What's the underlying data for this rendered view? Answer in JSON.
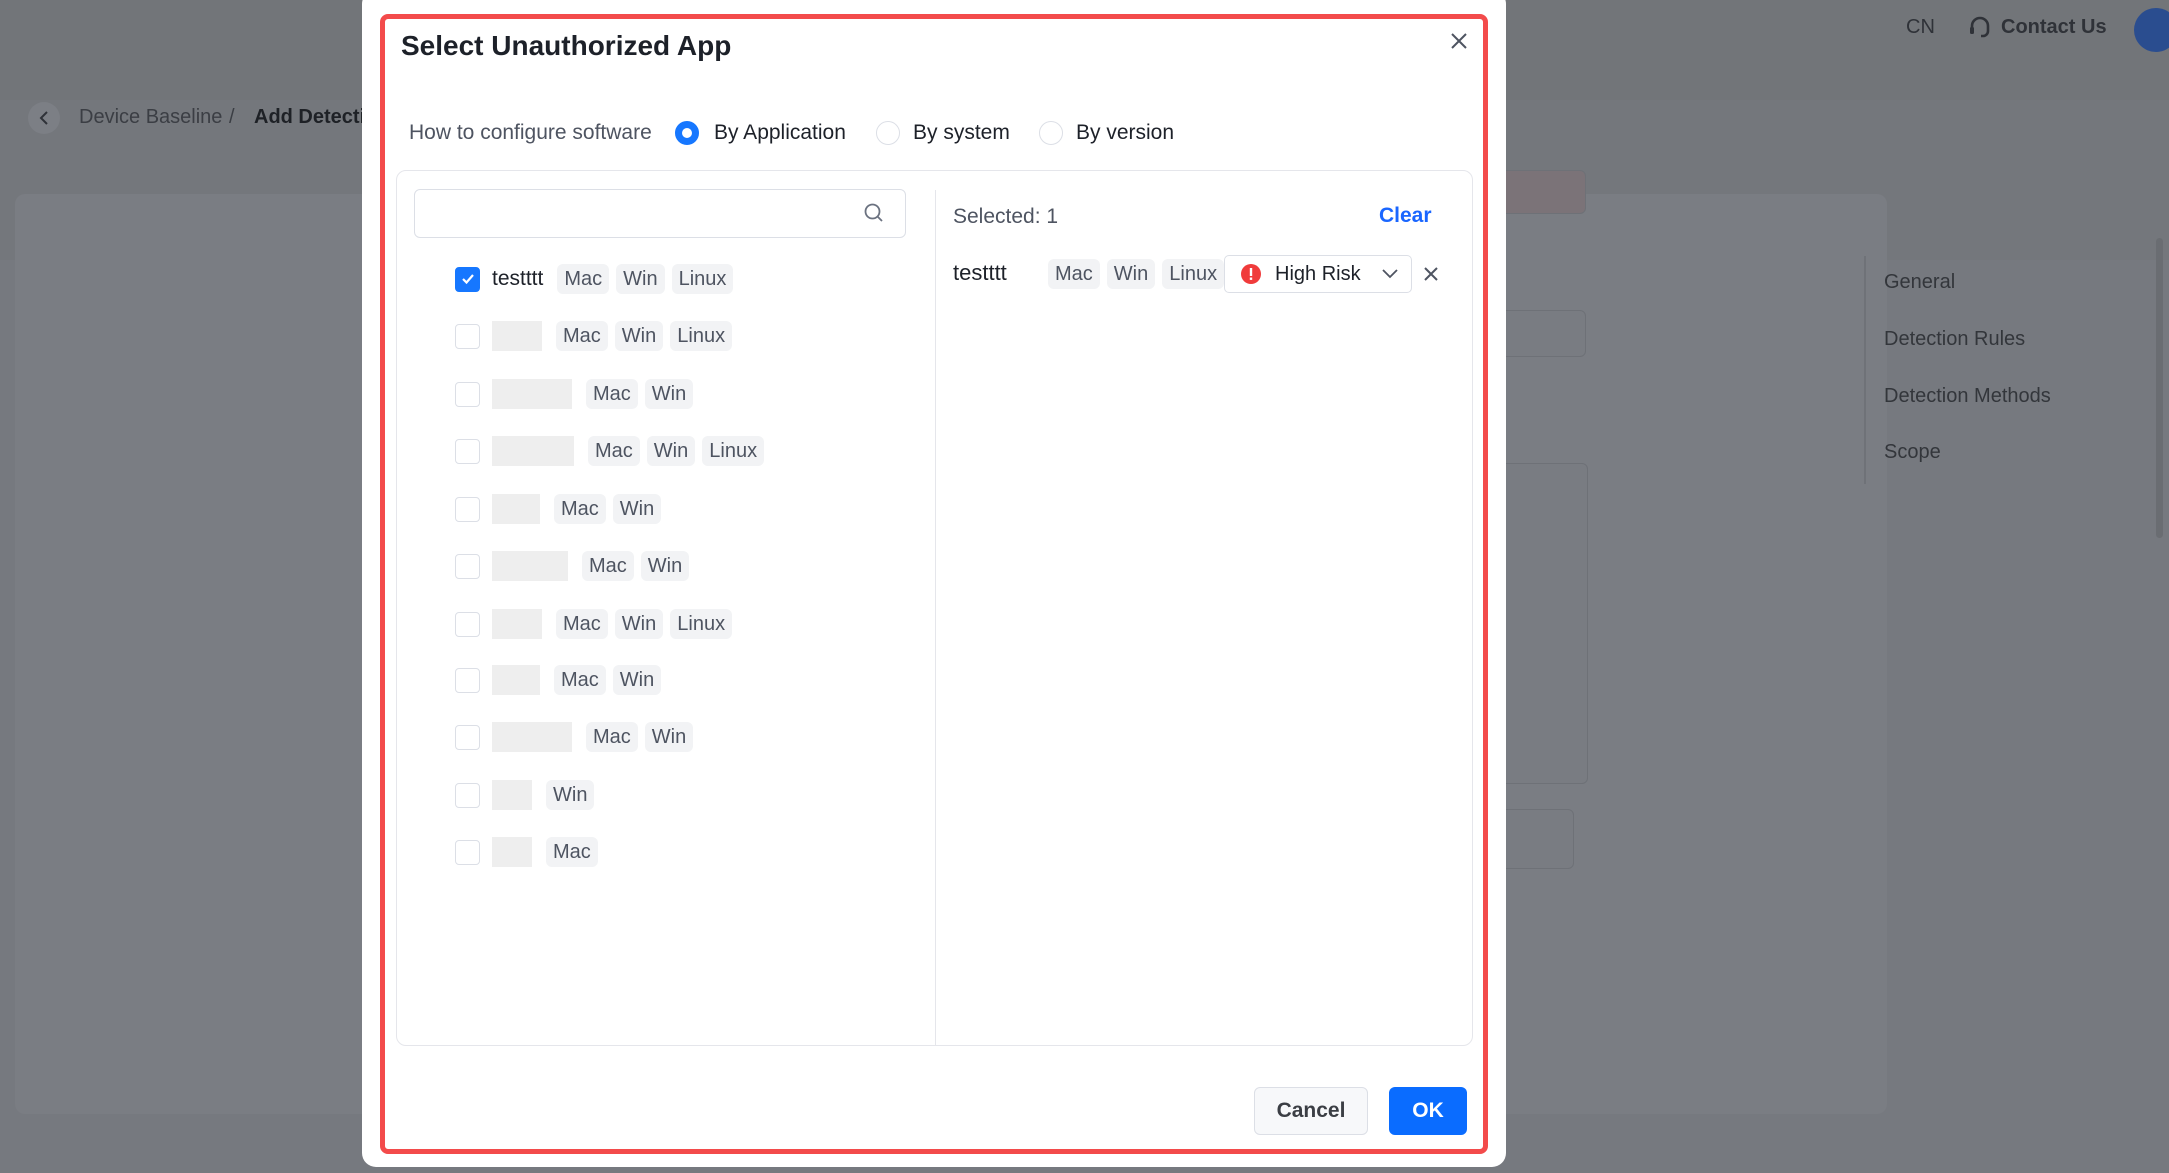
{
  "header": {
    "lang": "CN",
    "contact": "Contact Us"
  },
  "breadcrumb": {
    "items": [
      "Device Baseline",
      "Add Detectic"
    ],
    "separator": "/"
  },
  "side_nav": [
    "General",
    "Detection Rules",
    "Detection Methods",
    "Scope"
  ],
  "dialog": {
    "title": "Select Unauthorized App",
    "config_label": "How to configure software",
    "options": [
      "By Application",
      "By system",
      "By version"
    ],
    "selected_option": "By Application",
    "search": {
      "placeholder": "",
      "value": ""
    },
    "list": [
      {
        "name": "testttt",
        "checked": true,
        "tags": [
          "Mac",
          "Win",
          "Linux"
        ]
      },
      {
        "name": "",
        "checked": false,
        "tags": [
          "Mac",
          "Win",
          "Linux"
        ]
      },
      {
        "name": "",
        "checked": false,
        "tags": [
          "Mac",
          "Win"
        ]
      },
      {
        "name": "",
        "checked": false,
        "tags": [
          "Mac",
          "Win",
          "Linux"
        ]
      },
      {
        "name": "",
        "checked": false,
        "tags": [
          "Mac",
          "Win"
        ]
      },
      {
        "name": "",
        "checked": false,
        "tags": [
          "Mac",
          "Win"
        ]
      },
      {
        "name": "",
        "checked": false,
        "tags": [
          "Mac",
          "Win",
          "Linux"
        ]
      },
      {
        "name": "",
        "checked": false,
        "tags": [
          "Mac",
          "Win"
        ]
      },
      {
        "name": "",
        "checked": false,
        "tags": [
          "Mac",
          "Win"
        ]
      },
      {
        "name": "",
        "checked": false,
        "tags": [
          "Win"
        ]
      },
      {
        "name": "",
        "checked": false,
        "tags": [
          "Mac"
        ]
      }
    ],
    "selected_count_label": "Selected: 1",
    "clear_label": "Clear",
    "selected_items": [
      {
        "name": "testttt",
        "tags": [
          "Mac",
          "Win",
          "Linux"
        ],
        "risk": "High Risk"
      }
    ],
    "cancel_label": "Cancel",
    "ok_label": "OK"
  },
  "colors": {
    "primary": "#1677ff",
    "highlight_frame": "#f34b4b",
    "risk_icon": "#f03b3b"
  }
}
